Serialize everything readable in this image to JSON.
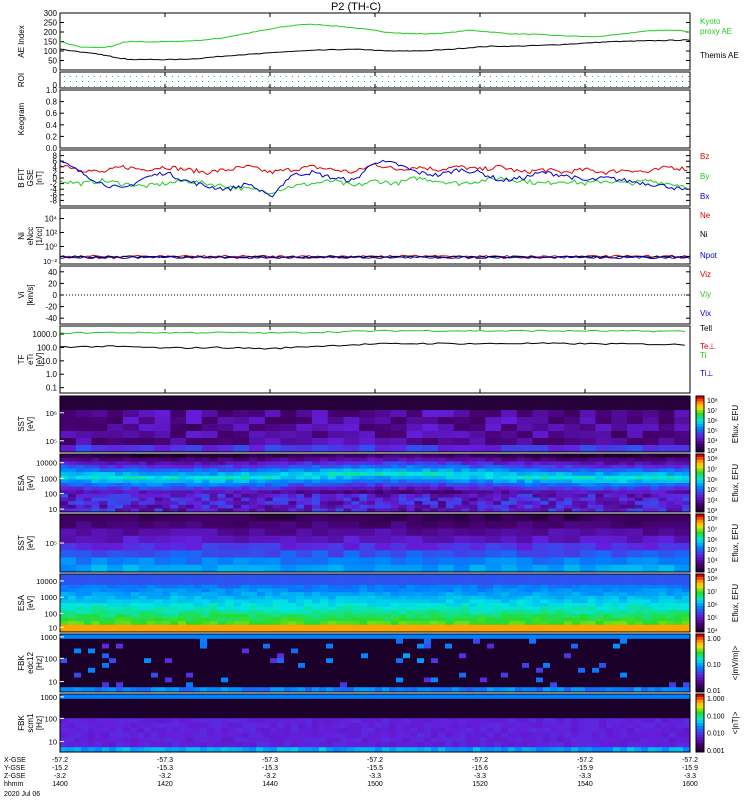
{
  "title": "P2 (TH-C)",
  "date_label": "2020 Jul 06",
  "colors": {
    "ae_kyoto": "#22cc22",
    "ae_themis": "#000000",
    "bz": "#dd0000",
    "by": "#22cc22",
    "bx": "#0000cc",
    "ne": "#dd0000",
    "ni": "#000000",
    "npot": "#0000cc",
    "vx": "#0000cc",
    "te": "#dd0000",
    "ti": "#22cc22",
    "tperp": "#0000cc",
    "roi_dots": "#20b0b0"
  },
  "x_axis": {
    "tick_labels": [
      "1400",
      "1420",
      "1440",
      "1500",
      "1520",
      "1540",
      "1600"
    ],
    "rows": [
      {
        "label": "X-GSE",
        "values": [
          "-57.2",
          "-57.3",
          "-57.3",
          "-57.2",
          "-57.2",
          "-57.2",
          "-57.2"
        ]
      },
      {
        "label": "Y-GSE",
        "values": [
          "-15.2",
          "-15.3",
          "-15.3",
          "-15.5",
          "-15.6",
          "-15.9",
          "-15.9"
        ]
      },
      {
        "label": "Z-GSE",
        "values": [
          "-3.2",
          "-3.2",
          "-3.2",
          "-3.3",
          "-3.3",
          "-3.3",
          "-3.3"
        ]
      },
      {
        "label": "hhmm",
        "values": [
          "1400",
          "1420",
          "1440",
          "1500",
          "1520",
          "1540",
          "1600"
        ]
      }
    ]
  },
  "chart_data": [
    {
      "type": "line",
      "panel": "ae",
      "ylabel": "AE Index",
      "ylim": [
        0,
        300
      ],
      "y_ticks": [
        "0",
        "50",
        "100",
        "150",
        "200",
        "250",
        "300"
      ],
      "x": [
        1400,
        1404,
        1408,
        1410,
        1412,
        1414,
        1418,
        1422,
        1426,
        1430,
        1434,
        1438,
        1442,
        1446,
        1450,
        1454,
        1458,
        1502,
        1506,
        1510,
        1514,
        1518,
        1522,
        1526,
        1530,
        1534,
        1538,
        1542,
        1546,
        1550,
        1554,
        1558,
        1600
      ],
      "series": [
        {
          "name": "Kyoto proxy AE",
          "values": [
            150,
            120,
            118,
            125,
            145,
            150,
            148,
            150,
            155,
            165,
            185,
            205,
            225,
            240,
            238,
            228,
            215,
            200,
            192,
            190,
            196,
            210,
            200,
            190,
            188,
            182,
            178,
            175,
            185,
            200,
            210,
            208,
            200
          ]
        },
        {
          "name": "Themis AE",
          "values": [
            110,
            95,
            80,
            70,
            60,
            55,
            55,
            55,
            60,
            70,
            80,
            85,
            95,
            100,
            105,
            108,
            108,
            100,
            100,
            102,
            108,
            118,
            125,
            125,
            128,
            132,
            138,
            145,
            150,
            152,
            155,
            157,
            158
          ]
        }
      ]
    },
    {
      "type": "line",
      "panel": "roi",
      "ylabel": "ROI",
      "y_ticks": [
        "0"
      ]
    },
    {
      "type": "line",
      "panel": "keogram",
      "ylabel": "Keogram",
      "ylim": [
        0,
        1
      ],
      "y_ticks": [
        "0.0",
        "0.2",
        "0.4",
        "0.6",
        "0.8",
        "1.0"
      ]
    },
    {
      "type": "line",
      "panel": "bfield",
      "ylabel": "B FIT",
      "ylabel2": "[nT]",
      "ylabel3": "GSE",
      "ylim": [
        -10,
        10
      ],
      "y_ticks": [
        "-8",
        "-6",
        "-4",
        "-2",
        "0",
        "2",
        "4",
        "6",
        "8"
      ],
      "x": [
        1400,
        1404,
        1408,
        1412,
        1416,
        1420,
        1424,
        1428,
        1432,
        1436,
        1440,
        1444,
        1448,
        1452,
        1456,
        1500,
        1504,
        1508,
        1512,
        1516,
        1520,
        1524,
        1528,
        1532,
        1536,
        1540,
        1544,
        1548,
        1552,
        1556,
        1600
      ],
      "series": [
        {
          "name": "Bz",
          "values": [
            5,
            3,
            2,
            4,
            3,
            4,
            3,
            2,
            3,
            4,
            2,
            3,
            4,
            3,
            2,
            5,
            3,
            4,
            3,
            4,
            3,
            4,
            2,
            3,
            2,
            3,
            2,
            3,
            2,
            4,
            3
          ]
        },
        {
          "name": "By",
          "values": [
            -1,
            -2,
            -1,
            -2,
            -3,
            -2,
            -1,
            -2,
            -3,
            -4,
            -5,
            -3,
            -2,
            -1,
            -3,
            -1,
            -2,
            0,
            -1,
            -2,
            -1,
            0,
            -1,
            -2,
            -1,
            -2,
            -1,
            -2,
            -1,
            -2,
            -3
          ]
        },
        {
          "name": "Bx",
          "values": [
            6,
            2,
            -2,
            -4,
            0,
            2,
            -1,
            -3,
            -4,
            -2,
            -7,
            1,
            2,
            0,
            -1,
            6,
            5,
            2,
            1,
            3,
            2,
            -1,
            0,
            2,
            1,
            -1,
            0,
            -1,
            -2,
            -3,
            -5
          ]
        }
      ]
    },
    {
      "type": "line",
      "panel": "density",
      "ylabel": "Ni",
      "ylabel2": "[1/cc]",
      "ylabel3": "eNcc",
      "log": true,
      "y_ticks_major": [
        "10⁴",
        "10²",
        "10⁰"
      ],
      "y_tick_bottom": "10⁻²",
      "series": [
        {
          "name": "Ne"
        },
        {
          "name": "Ni"
        },
        {
          "name": "Npot"
        }
      ]
    },
    {
      "type": "line",
      "panel": "velocity",
      "ylabel": "Vi",
      "ylabel2": "[km/s]",
      "ylim": [
        -50,
        50
      ],
      "y_ticks": [
        "-40",
        "-20",
        "0",
        "20",
        "40"
      ],
      "series": [
        {
          "name": "Vix"
        },
        {
          "name": "Viy"
        },
        {
          "name": "Viz"
        }
      ]
    },
    {
      "type": "line",
      "panel": "temperature",
      "ylabel": "TF",
      "ylabel2": "[eV]",
      "ylabel3": "eTi",
      "log": true,
      "y_ticks": [
        "0.1",
        "1.0",
        "10.0",
        "100.0",
        "1000.0"
      ],
      "x": [
        1400,
        1410,
        1420,
        1430,
        1440,
        1450,
        1500,
        1510,
        1520,
        1530,
        1540,
        1550,
        1600
      ],
      "series": [
        {
          "name": "Ti",
          "values": [
            1200,
            1300,
            1250,
            1300,
            1200,
            1400,
            1700,
            1800,
            1700,
            1750,
            1700,
            1650,
            1600
          ]
        },
        {
          "name": "Te",
          "values": [
            110,
            120,
            90,
            100,
            80,
            130,
            180,
            200,
            190,
            200,
            190,
            180,
            160
          ]
        },
        {
          "name": "Tell"
        },
        {
          "name": "Te⊥"
        },
        {
          "name": "Ti⊥"
        }
      ]
    },
    {
      "type": "heatmap",
      "panel": "sst_i",
      "ylabel": "SST",
      "ylabel2": "[eV]",
      "y_ticks": [
        "10⁶",
        "10⁵"
      ],
      "colorbar_label": "Eflux, EFU",
      "colorbar_ticks": [
        "10⁸",
        "10⁷",
        "10⁶",
        "10⁵",
        "10⁴",
        "10³"
      ]
    },
    {
      "type": "heatmap",
      "panel": "esa_i",
      "ylabel": "ESA",
      "ylabel2": "[eV]",
      "y_ticks": [
        "10000",
        "1000",
        "100",
        "10"
      ],
      "colorbar_label": "Eflux, EFU",
      "colorbar_ticks": [
        "10⁸",
        "10⁷",
        "10⁶",
        "10⁵",
        "10⁴",
        "10³"
      ]
    },
    {
      "type": "heatmap",
      "panel": "sst_e",
      "ylabel": "SST",
      "ylabel2": "[eV]",
      "y_ticks": [
        "10⁵"
      ],
      "colorbar_label": "Eflux, EFU",
      "colorbar_ticks": [
        "10⁸",
        "10⁷",
        "10⁶",
        "10⁵",
        "10⁴",
        "10³"
      ]
    },
    {
      "type": "heatmap",
      "panel": "esa_e",
      "ylabel": "ESA",
      "ylabel2": "[eV]",
      "y_ticks": [
        "10000",
        "1000",
        "100",
        "10"
      ],
      "colorbar_label": "Eflux, EFU",
      "colorbar_ticks": [
        "10⁸",
        "10⁷",
        "10⁶",
        "10⁵",
        "10⁴"
      ]
    },
    {
      "type": "heatmap",
      "panel": "fbk_e",
      "ylabel": "FBK",
      "ylabel2": "[Hz]",
      "ylabel3": "edc12",
      "y_ticks": [
        "1000",
        "100",
        "10"
      ],
      "colorbar_label": "<|mV/m|>",
      "colorbar_ticks": [
        "1.00",
        "0.10",
        "0.01"
      ]
    },
    {
      "type": "heatmap",
      "panel": "fbk_b",
      "ylabel": "FBK",
      "ylabel2": "[Hz]",
      "ylabel3": "scm1",
      "y_ticks": [
        "1000",
        "100",
        "10"
      ],
      "colorbar_label": "<|nT|>",
      "colorbar_ticks": [
        "1.000",
        "0.100",
        "0.010",
        "0.001"
      ]
    }
  ]
}
